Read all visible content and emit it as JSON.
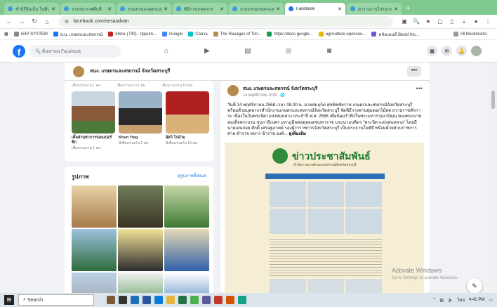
{
  "browser": {
    "tabs": [
      {
        "label": "ชั่วนิรีดีอเน็น ในคืน",
        "active": false
      },
      {
        "label": "ร่างประกาศคืนที่",
        "active": false
      },
      {
        "label": "กรองกรมเกษตรและ",
        "active": false
      },
      {
        "label": "พิธีการเกษตรกร",
        "active": false
      },
      {
        "label": "กรองกรมเกษตรและ",
        "active": false
      },
      {
        "label": "Facebook",
        "active": true
      },
      {
        "label": "ตารางงานโปรแกรม",
        "active": false
      }
    ],
    "url": "facebook.com/sesaralvan",
    "bookmarks": [
      "G4P SYSTEM",
      "ส.น. เกษตรและสหกรณ์",
      "Inbox (740) - tippum...",
      "Google",
      "Canva",
      "The Ravages of Tim...",
      "https://docs.google...",
      "agriculture.opensou...",
      "คลังแผนที่ Bookl Inc...",
      "All Bookmarks"
    ]
  },
  "facebook": {
    "search_placeholder": "ค้นหาบน Facebook",
    "page_name": "สนง. เกษตรและสหกรณ์ จังหวัดสระบุรี",
    "friends_caption": [
      "เพื่อนร่วมงาน 1 คน",
      "เพื่อนร่วมงาน 1 คน",
      "เพื่อนร่วมงาน 10 คน"
    ],
    "friends": [
      {
        "name": "เติ้ลส่วนท่าการบ่อนเปอร์ซิก",
        "mutual": "เพื่อนร่วมงาน 1 คน"
      },
      {
        "name": "Khun Ying",
        "mutual": "มีเพื่อนร่วมกัน 2 คน"
      },
      {
        "name": "อัศวิ โกอ้าม",
        "mutual": "มีเพื่อนร่วมกัน 13 คน"
      }
    ],
    "photos_title": "รูปภาพ",
    "photos_link": "ดูรูปภาพทั้งหมด",
    "post": {
      "author": "สนง. เกษตรและสหกรณ์ จังหวัดสระบุรี",
      "date": "14 พฤศจิกายน 2025 · 🌐",
      "text": "วันที่ 14 พฤศจิกายน 2568 เวลา 08.00 น. นายสมฤกิต สุขพิชชัยราช เกษตรและสหกรณ์จังหวัดสระบุรี พร้อมด้วยบุคลากรสำนักงานเกษตรและสหกรณ์จังหวัดสระบุรี จัดพิธีวางพานพุ่มดอกไม้สด ถวายราชสักการะ เนื่องในวันพระบิดาแห่งฝนหลวง ประจำปี พ.ศ. 2568 เพื่อน้อมรำลึกในพระมหากรุณาธิคุณ ของพระบาทสมเด็จพระบรม ชนกาธิเบศร มหาภูมิพลอดุลยเดชมหาราช บรมนาถบพิตร \"พระบิดาแห่งฝนหลวง\" โดยมี นายเอนก่อย ศักดิ์ เศรษฐภาคย์ รองผู้ว่าราชการจังหวัดสระบุรี เป็นประธานในพิธี พร้อมด้วยส่วนราชการ ศาล ตำรวจ ทหาร ข้าราช องค์...",
      "see_more": "ดูเพิ่มเติม",
      "poster_title": "ข่าวประชาสัมพันธ์",
      "poster_sub": "สำนักงานเกษตรและสหกรณ์จังหวัดสระบุรี"
    },
    "activate_title": "Activate Windows",
    "activate_sub": "Go to Settings to activate Windows."
  },
  "taskbar": {
    "search": "Search",
    "time": "4:41 PM",
    "lang": "ไทย"
  },
  "colors": {
    "fb_blue": "#1877f2",
    "tab_green": "#7fc88f"
  }
}
